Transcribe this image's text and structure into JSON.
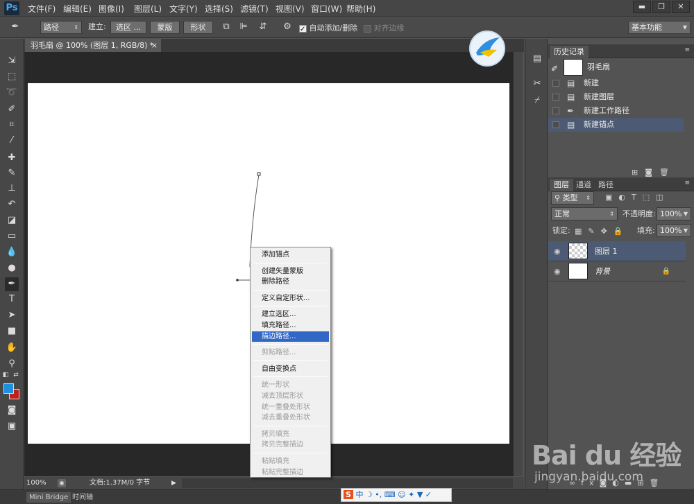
{
  "app": {
    "logo_text": "Ps"
  },
  "menu": [
    "文件(F)",
    "编辑(E)",
    "图像(I)",
    "图层(L)",
    "文字(Y)",
    "选择(S)",
    "滤镜(T)",
    "视图(V)",
    "窗口(W)",
    "帮助(H)"
  ],
  "window_controls": {
    "minimize": "▬",
    "restore": "❐",
    "close": "✕"
  },
  "options": {
    "mode_dropdown": "路径",
    "make_label": "建立:",
    "selection_btn": "选区 ...",
    "mask_btn": "蒙版",
    "shape_btn": "形状",
    "auto_add_delete": "自动添加/删除",
    "auto_add_delete_checked": true,
    "align_edges": "对齐边缘",
    "align_edges_checked": false,
    "workspace": "基本功能"
  },
  "document": {
    "tab_title": "羽毛扇 @ 100% (图层 1, RGB/8) *",
    "close_glyph": "×",
    "zoom": "100%",
    "doc_info": "文档:1.37M/0 字节"
  },
  "bottom_tabs": [
    "Mini Bridge",
    "时间轴"
  ],
  "context_menu": {
    "items": [
      {
        "label": "添加锚点",
        "enabled": true
      },
      {
        "sep": true
      },
      {
        "label": "创建矢量蒙版",
        "enabled": true
      },
      {
        "label": "删除路径",
        "enabled": true
      },
      {
        "sep": true
      },
      {
        "label": "定义自定形状...",
        "enabled": true
      },
      {
        "sep": true
      },
      {
        "label": "建立选区...",
        "enabled": true
      },
      {
        "label": "填充路径...",
        "enabled": true
      },
      {
        "label": "描边路径...",
        "enabled": true,
        "selected": true
      },
      {
        "sep": true
      },
      {
        "label": "剪贴路径...",
        "enabled": false
      },
      {
        "sep": true
      },
      {
        "label": "自由变换点",
        "enabled": true
      },
      {
        "sep": true
      },
      {
        "label": "统一形状",
        "enabled": false
      },
      {
        "label": "减去顶层形状",
        "enabled": false
      },
      {
        "label": "统一重叠处形状",
        "enabled": false
      },
      {
        "label": "减去重叠处形状",
        "enabled": false
      },
      {
        "sep": true
      },
      {
        "label": "拷贝填充",
        "enabled": false
      },
      {
        "label": "拷贝完整描边",
        "enabled": false
      },
      {
        "sep": true
      },
      {
        "label": "粘贴填充",
        "enabled": false
      },
      {
        "label": "粘贴完整描边",
        "enabled": false
      }
    ]
  },
  "history": {
    "tab": "历史记录",
    "snapshot": "羽毛扇",
    "items": [
      {
        "label": "新建",
        "icon": "document-icon"
      },
      {
        "label": "新建图层",
        "icon": "document-icon"
      },
      {
        "label": "新建工作路径",
        "icon": "pen-icon"
      },
      {
        "label": "新建锚点",
        "icon": "document-icon",
        "selected": true
      }
    ]
  },
  "layers_panel": {
    "tabs": [
      "图层",
      "通道",
      "路径"
    ],
    "filter": "类型",
    "blend_mode": "正常",
    "opacity_label": "不透明度:",
    "opacity": "100%",
    "lock_label": "锁定:",
    "fill_label": "填充:",
    "fill": "100%",
    "layers": [
      {
        "name": "图层 1",
        "selected": true,
        "transparent": true
      },
      {
        "name": "背景",
        "selected": false,
        "transparent": false,
        "locked": true
      }
    ]
  },
  "watermark": {
    "text": "Bai du 经验",
    "url": "jingyan.baidu.com"
  },
  "colors": {
    "foreground": "#1f8fe0",
    "background": "#c0201b",
    "selection": "#3168c6"
  }
}
